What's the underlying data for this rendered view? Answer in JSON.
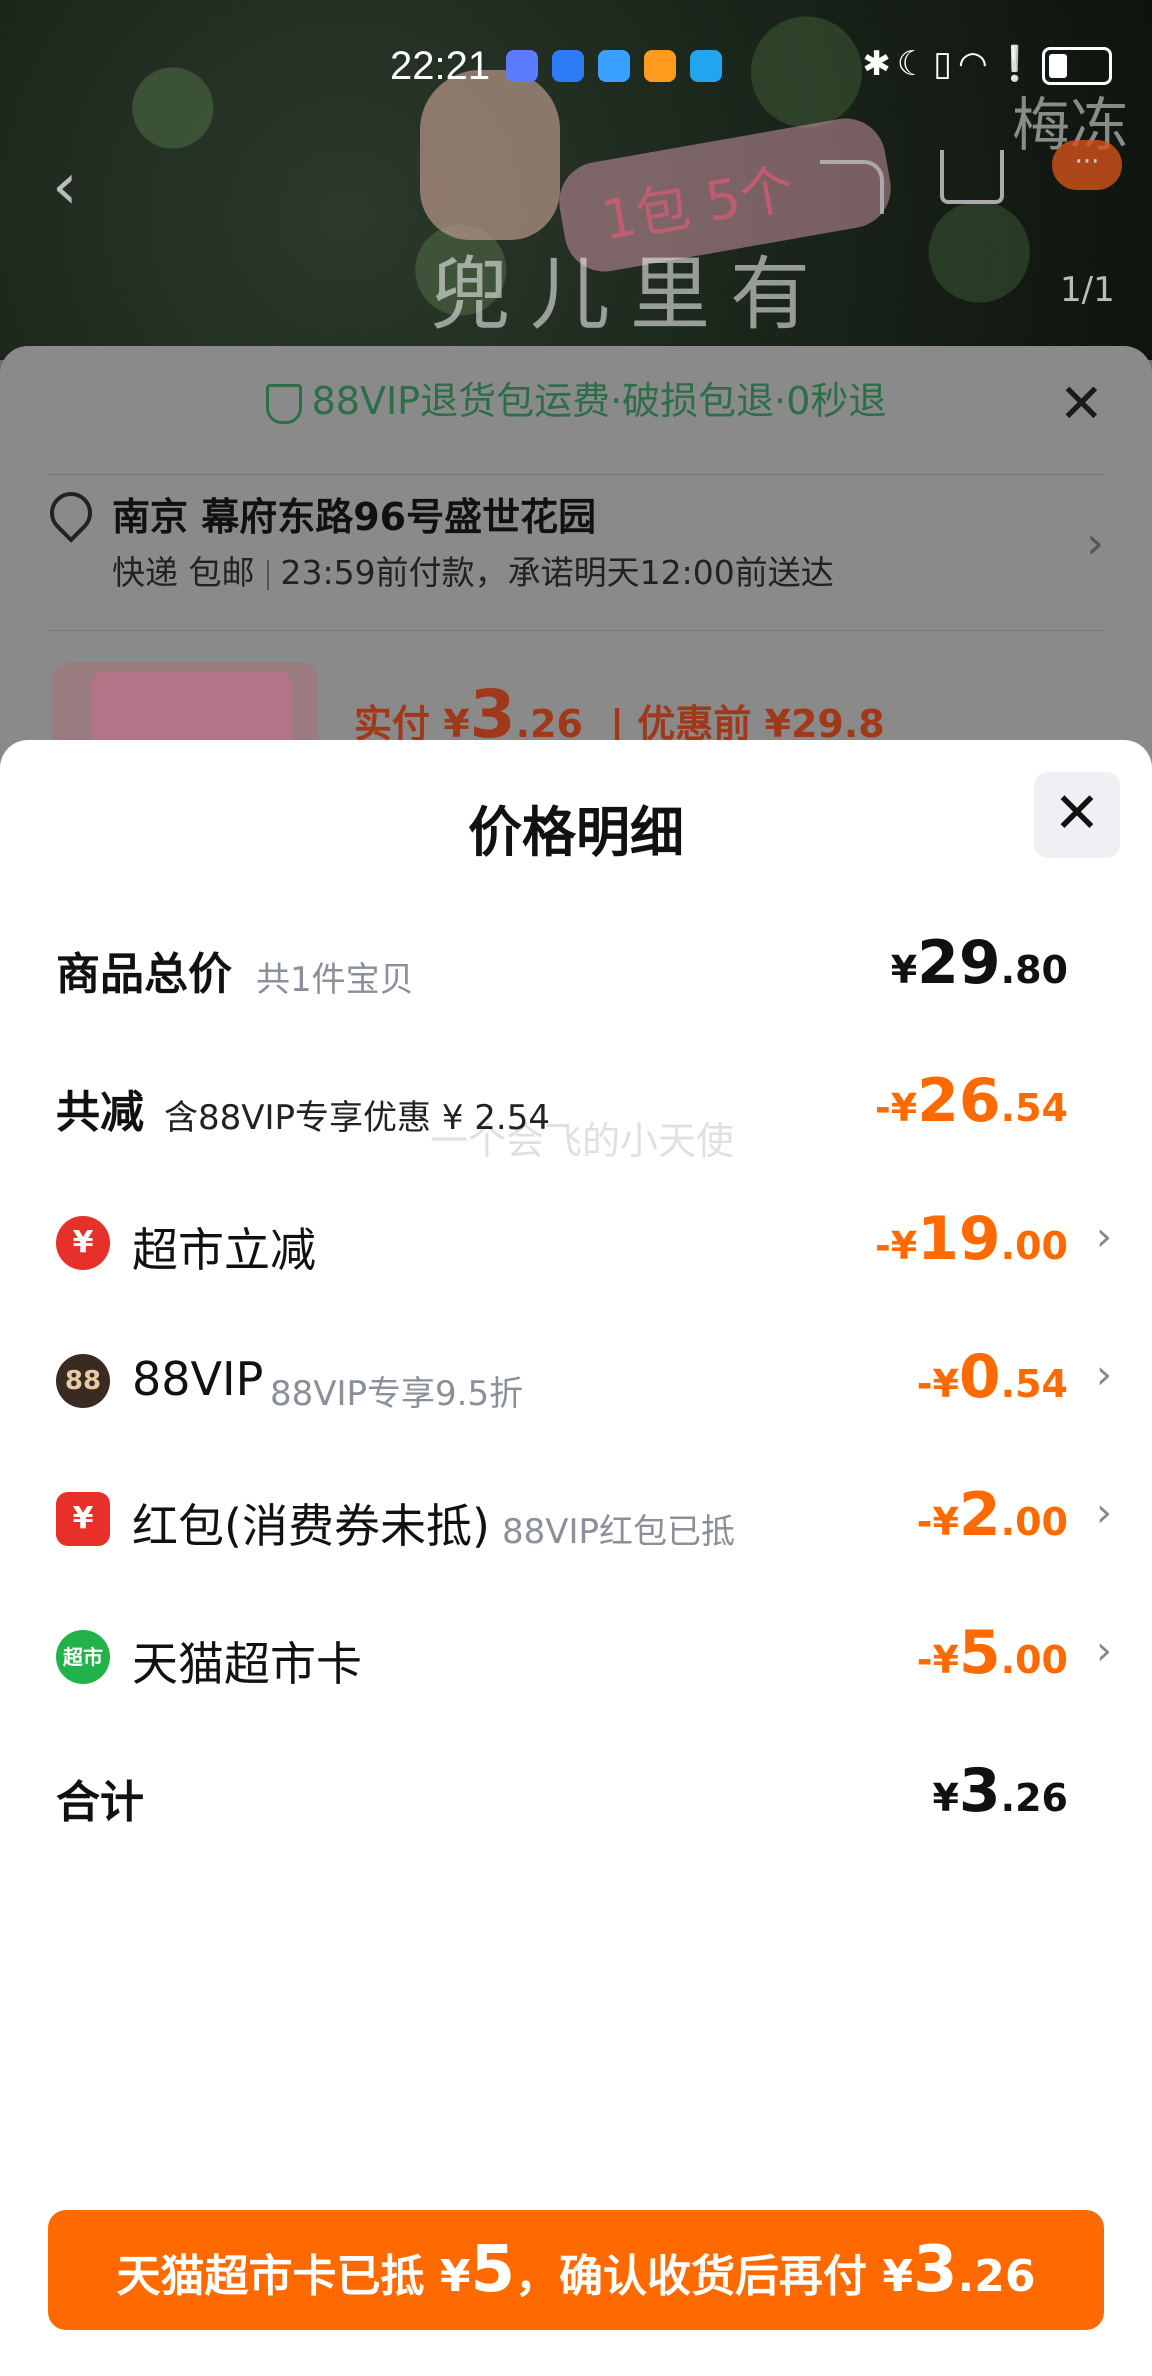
{
  "status_bar": {
    "time": "22:21"
  },
  "background": {
    "image_counter": "1/1",
    "brand_text": "梅冻",
    "sticker_text": "1包 5个",
    "hand_text": "兜儿里有"
  },
  "order_sheet": {
    "guarantee": "88VIP退货包运费·破损包退·0秒退",
    "address": "南京 幕府东路96号盛世花园",
    "shipping_method": "快递 包邮",
    "shipping_promise": "23:59前付款，承诺明天12:00前送达",
    "paid_label": "实付 ¥",
    "paid_big": "3",
    "paid_dec": ".26",
    "before_label": "| 优惠前 ¥29.8"
  },
  "price_detail": {
    "title": "价格明细",
    "rows": [
      {
        "label": "商品总价",
        "sub": "共1件宝贝",
        "cny": "¥",
        "int": "29",
        "dec": ".80"
      },
      {
        "label": "共减",
        "sub": "含88VIP专享优惠 ¥ 2.54",
        "cny": "-¥",
        "int": "26",
        "dec": ".54"
      },
      {
        "label": "超市立减",
        "sub": "",
        "cny": "-¥",
        "int": "19",
        "dec": ".00",
        "icon": "¥"
      },
      {
        "label": "88VIP",
        "sub": "88VIP专享9.5折",
        "cny": "-¥",
        "int": "0",
        "dec": ".54",
        "icon": "88"
      },
      {
        "label": "红包(消费券未抵)",
        "sub": "88VIP红包已抵",
        "cny": "-¥",
        "int": "2",
        "dec": ".00",
        "icon": "¥"
      },
      {
        "label": "天猫超市卡",
        "sub": "",
        "cny": "-¥",
        "int": "5",
        "dec": ".00",
        "icon": "超市"
      },
      {
        "label": "合计",
        "sub": "",
        "cny": "¥",
        "int": "3",
        "dec": ".26"
      }
    ],
    "watermark": "一个会飞的小天使"
  },
  "cta": {
    "part1": "天猫超市卡已抵 ¥",
    "big1": "5",
    "part2": "，确认收货后再付 ¥",
    "big2": "3",
    "dec2": ".26"
  },
  "colors": {
    "accent": "#ff6a00",
    "guarantee_green": "#2c6e47"
  },
  "icons": [
    "chevron-left-icon",
    "share-icon",
    "cart-icon",
    "more-icon",
    "shield-icon",
    "location-icon",
    "close-icon",
    "chevron-right-icon",
    "supermarket-discount-icon",
    "vip88-icon",
    "red-packet-icon",
    "tmall-card-icon"
  ]
}
